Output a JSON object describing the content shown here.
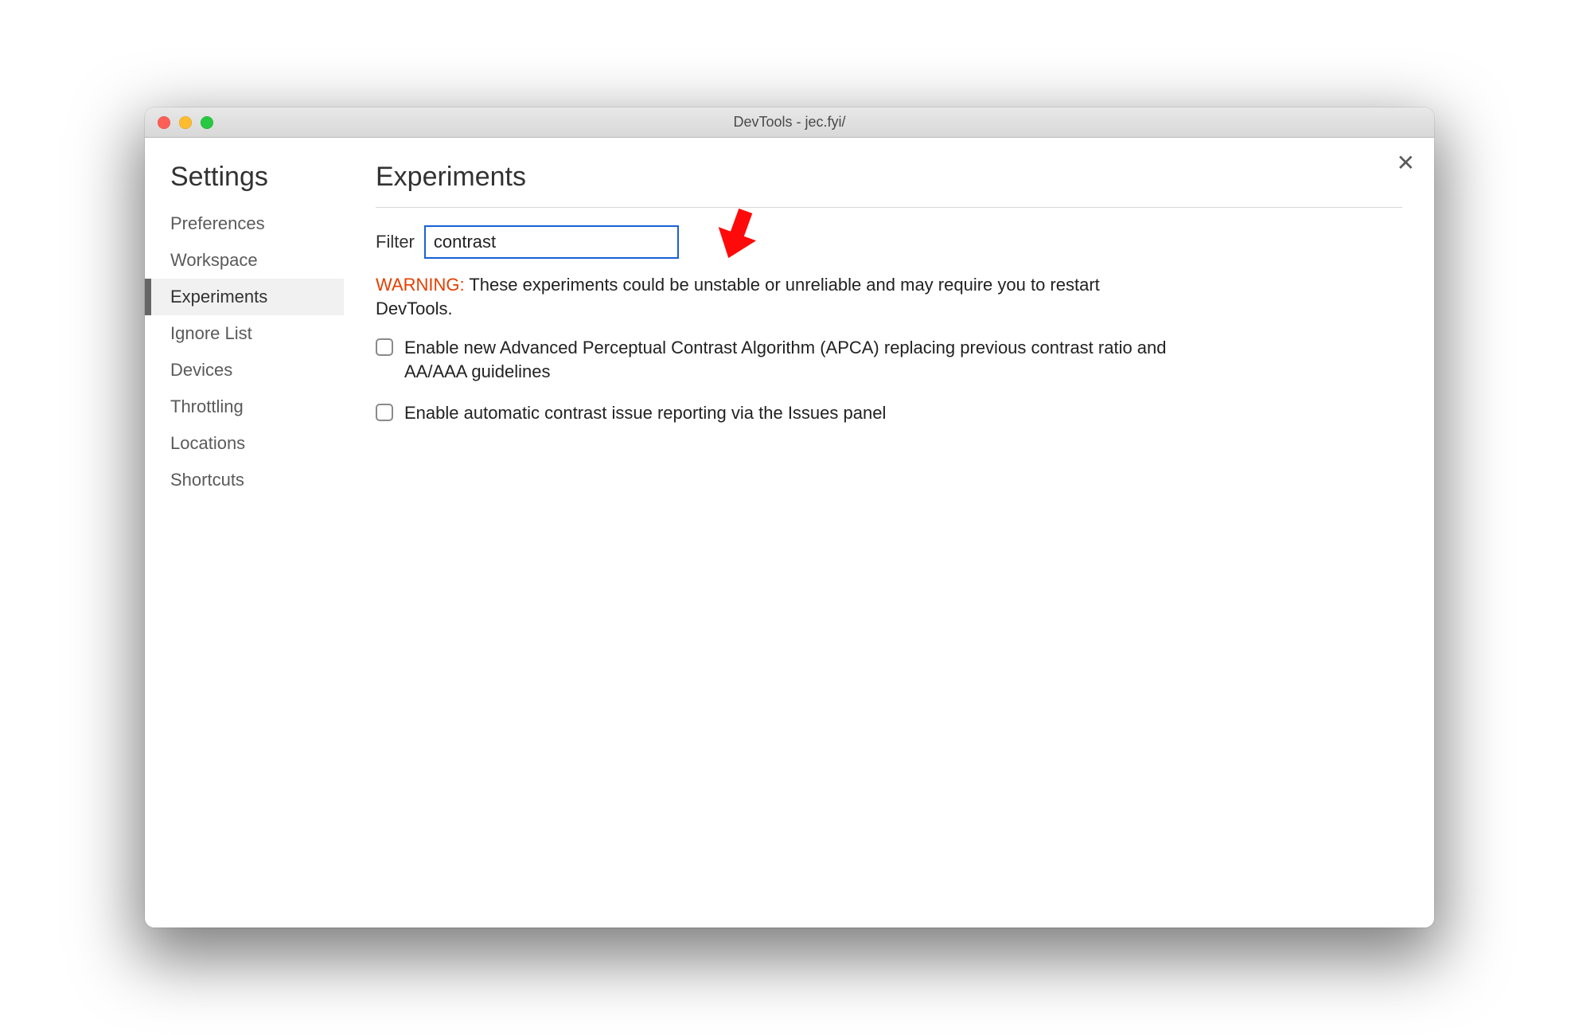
{
  "window": {
    "title": "DevTools - jec.fyi/"
  },
  "sidebar": {
    "title": "Settings",
    "items": [
      {
        "label": "Preferences",
        "active": false
      },
      {
        "label": "Workspace",
        "active": false
      },
      {
        "label": "Experiments",
        "active": true
      },
      {
        "label": "Ignore List",
        "active": false
      },
      {
        "label": "Devices",
        "active": false
      },
      {
        "label": "Throttling",
        "active": false
      },
      {
        "label": "Locations",
        "active": false
      },
      {
        "label": "Shortcuts",
        "active": false
      }
    ]
  },
  "main": {
    "title": "Experiments",
    "filter_label": "Filter",
    "filter_value": "contrast",
    "warning_prefix": "WARNING:",
    "warning_text": " These experiments could be unstable or unreliable and may require you to restart DevTools.",
    "experiments": [
      {
        "label": "Enable new Advanced Perceptual Contrast Algorithm (APCA) replacing previous contrast ratio and AA/AAA guidelines",
        "checked": false
      },
      {
        "label": "Enable automatic contrast issue reporting via the Issues panel",
        "checked": false
      }
    ]
  },
  "annotation": {
    "arrow_color": "#ff0a0a"
  }
}
